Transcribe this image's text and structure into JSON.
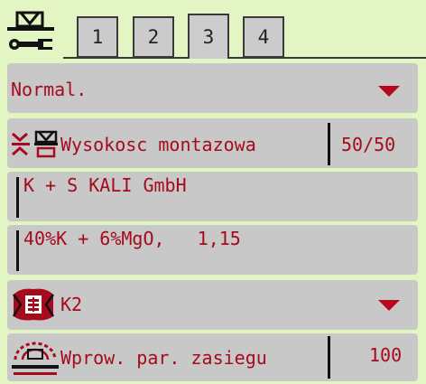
{
  "tabs": [
    {
      "label": "1",
      "active": false
    },
    {
      "label": "2",
      "active": false
    },
    {
      "label": "3",
      "active": true
    },
    {
      "label": "4",
      "active": false
    }
  ],
  "rows": {
    "mode": {
      "value": "Normal."
    },
    "mounting_height": {
      "label": "Wysokosc montazowa",
      "value": "50/50"
    },
    "manufacturer": {
      "value": "K + S KALI GmbH"
    },
    "fertilizer": {
      "value": "40%K + 6%MgO,   1,15"
    },
    "disc_type": {
      "value": "K2"
    },
    "range_param": {
      "label": "Wprow. par. zasiegu",
      "value": "100"
    }
  },
  "colors": {
    "background": "#e2f5c2",
    "row_background": "#c8c8c8",
    "text_accent": "#a50b1c",
    "arrow": "#b5091e"
  },
  "icons": {
    "settings": "spreader-wrench-icon",
    "height": "mounting-height-icon",
    "disc": "spreading-disc-icon",
    "range": "spread-range-icon",
    "dropdown": "dropdown-arrow-icon"
  }
}
